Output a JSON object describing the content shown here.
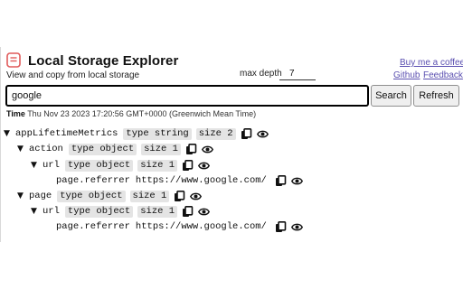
{
  "header": {
    "title": "Local Storage Explorer",
    "subtitle": "View and copy from local storage",
    "max_depth_label": "max depth",
    "max_depth_value": "7"
  },
  "links": {
    "coffee": "Buy me a coffee",
    "github": "Github",
    "feedback": "Feedback"
  },
  "search": {
    "query": "google",
    "search_label": "Search",
    "refresh_label": "Refresh"
  },
  "time": {
    "label": "Time",
    "value": "Thu Nov 23 2023 17:20:56 GMT+0000 (Greenwich Mean Time)"
  },
  "tree": [
    {
      "toggle": "▼",
      "key": "appLifetimeMetrics",
      "type": "type string",
      "size": "size 2",
      "value": ""
    },
    {
      "toggle": "▼",
      "key": "action",
      "type": "type object",
      "size": "size 1",
      "value": ""
    },
    {
      "toggle": "▼",
      "key": "url",
      "type": "type object",
      "size": "size 1",
      "value": ""
    },
    {
      "toggle": "",
      "key": "page.referrer",
      "type": "",
      "size": "",
      "value": "https://www.google.com/"
    },
    {
      "toggle": "▼",
      "key": "page",
      "type": "type object",
      "size": "size 1",
      "value": ""
    },
    {
      "toggle": "▼",
      "key": "url",
      "type": "type object",
      "size": "size 1",
      "value": ""
    },
    {
      "toggle": "",
      "key": "page.referrer",
      "type": "",
      "size": "",
      "value": "https://www.google.com/"
    }
  ],
  "icons": {
    "logo": "local-storage-logo-icon",
    "copy": "copy-icon",
    "view": "eye-icon"
  },
  "colors": {
    "accent": "#e05a5a",
    "link": "#5a4fb0",
    "badge_bg": "#e4e4e4"
  }
}
